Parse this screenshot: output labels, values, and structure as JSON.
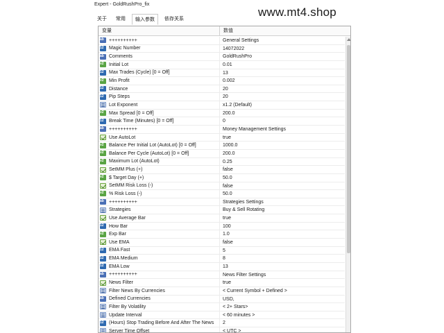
{
  "window": {
    "title": "Expert - GoldRushPro_fix"
  },
  "watermark": "www.mt4.shop",
  "tabs": [
    {
      "label": "关于"
    },
    {
      "label": "常用"
    },
    {
      "label": "输入参数",
      "active": true
    },
    {
      "label": "依存关系"
    }
  ],
  "table": {
    "headers": {
      "variable": "变量",
      "value": "数值"
    },
    "rows": [
      {
        "icon": "text",
        "name": "++++++++++",
        "value": "General Settings"
      },
      {
        "icon": "num",
        "name": "Magic Number",
        "value": "14072022"
      },
      {
        "icon": "text",
        "name": "Comments",
        "value": "GoldRushPro"
      },
      {
        "icon": "real",
        "name": "Initial Lot",
        "value": "0.01"
      },
      {
        "icon": "num",
        "name": "Max Trades (Cycle) [0 = Off]",
        "value": "13"
      },
      {
        "icon": "real",
        "name": "Min Profit",
        "value": "0.002"
      },
      {
        "icon": "num",
        "name": "Distance",
        "value": "20"
      },
      {
        "icon": "num",
        "name": "Pip Steps",
        "value": "20"
      },
      {
        "icon": "list",
        "name": "Lot Exponent",
        "value": "x1.2 (Default)"
      },
      {
        "icon": "real",
        "name": "Max Spread [0 = Off]",
        "value": "200.0"
      },
      {
        "icon": "num",
        "name": "Break Time (Minutes) [0 = Off]",
        "value": "0"
      },
      {
        "icon": "text",
        "name": "++++++++++",
        "value": "Money Management Settings"
      },
      {
        "icon": "bool",
        "name": "Use AutoLot",
        "value": "true"
      },
      {
        "icon": "real",
        "name": "Balance Per Initial Lot (AutoLot) [0 = Off]",
        "value": "1000.0"
      },
      {
        "icon": "real",
        "name": "Balance Per Cycle (AutoLot) [0 = Off]",
        "value": "200.0"
      },
      {
        "icon": "real",
        "name": "Maximum Lot (AutoLot)",
        "value": "0.25"
      },
      {
        "icon": "bool",
        "name": "SetMM Plus (+)",
        "value": "false"
      },
      {
        "icon": "real",
        "name": "$ Target Day (+)",
        "value": "50.0"
      },
      {
        "icon": "bool",
        "name": "SetMM Risk Loss (-)",
        "value": "false"
      },
      {
        "icon": "real",
        "name": "% Risk Loss (-)",
        "value": "50.0"
      },
      {
        "icon": "text",
        "name": "++++++++++",
        "value": "Strategies Settings"
      },
      {
        "icon": "list",
        "name": "Strategies",
        "value": "Buy & Sell Rotating"
      },
      {
        "icon": "bool",
        "name": "Use Average Bar",
        "value": "true"
      },
      {
        "icon": "num",
        "name": "How Bar",
        "value": "100"
      },
      {
        "icon": "real",
        "name": "Exp Bar",
        "value": "1.0"
      },
      {
        "icon": "bool",
        "name": "Use EMA",
        "value": "false"
      },
      {
        "icon": "num",
        "name": "EMA Fast",
        "value": "5"
      },
      {
        "icon": "num",
        "name": "EMA Medium",
        "value": "8"
      },
      {
        "icon": "num",
        "name": "EMA Low",
        "value": "13"
      },
      {
        "icon": "text",
        "name": "++++++++++",
        "value": "News Filter Settings"
      },
      {
        "icon": "bool",
        "name": "News Filter",
        "value": "true"
      },
      {
        "icon": "list",
        "name": "Filter News By Currencies",
        "value": "< Current Symbol + Defined >"
      },
      {
        "icon": "text",
        "name": "Defined Currencies",
        "value": "USD,"
      },
      {
        "icon": "list",
        "name": "Filter By Volatility",
        "value": "< 2+ Stars>"
      },
      {
        "icon": "list",
        "name": "Update Interval",
        "value": "< 60 minutes >"
      },
      {
        "icon": "num",
        "name": "(Hours) Stop Trading Before And After The News",
        "value": "2"
      },
      {
        "icon": "list",
        "name": "Server Time Offset",
        "value": "< UTC >"
      }
    ]
  }
}
